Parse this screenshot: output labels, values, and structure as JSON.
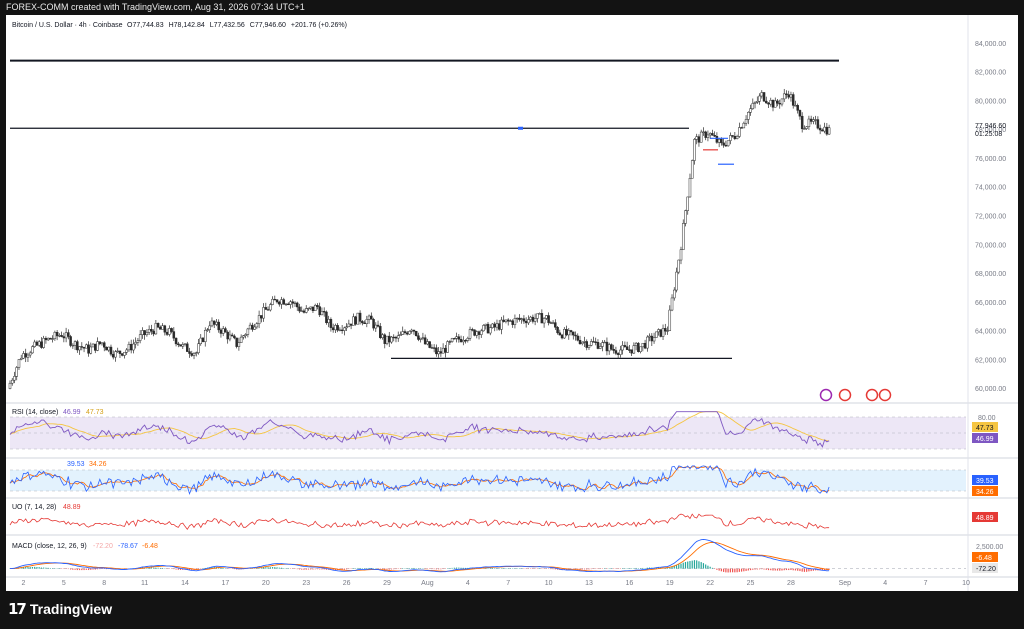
{
  "header_text": "FOREX-COMM created with TradingView.com, Aug 31, 2026 07:34 UTC+1",
  "symbol_line": {
    "name": "Bitcoin / U.S. Dollar · 4h · Coinbase",
    "o_label": "O",
    "o": "77,744.83",
    "h_label": "H",
    "h": "78,142.84",
    "l_label": "L",
    "l": "77,432.56",
    "c_label": "C",
    "c": "77,946.60",
    "change": "+201.76 (+0.26%)"
  },
  "price_axis": {
    "ticks": [
      "84,000.00",
      "82,000.00",
      "80,000.00",
      "78,000.00",
      "76,000.00",
      "74,000.00",
      "72,000.00",
      "70,000.00",
      "68,000.00",
      "66,000.00",
      "64,000.00",
      "62,000.00",
      "60,000.00"
    ],
    "current_price": "77,946.60",
    "countdown": "01:25:08"
  },
  "x_axis_ticks": [
    "2",
    "5",
    "8",
    "11",
    "14",
    "17",
    "20",
    "23",
    "26",
    "29",
    "Aug",
    "4",
    "7",
    "10",
    "13",
    "16",
    "19",
    "22",
    "25",
    "28",
    "Sep",
    "4",
    "7",
    "10"
  ],
  "indicators": {
    "rsi": {
      "title": "RSI (14, close)",
      "v1": "46.99",
      "v2": "47.73",
      "level": "80.00",
      "badge1": "47.73",
      "badge2": "46.99"
    },
    "stoch": {
      "v1": "39.53",
      "v2": "34.26",
      "badge1": "39.53",
      "badge2": "34.26"
    },
    "uo": {
      "title": "UO (7, 14, 28)",
      "v": "48.89",
      "badge": "48.89"
    },
    "macd": {
      "title": "MACD (close, 12, 26, 9)",
      "v1": "-72.20",
      "v2": "-78.67",
      "v3": "-6.48",
      "level": "2,500.00",
      "badge1": "-6.48",
      "badge2": "-72.20"
    }
  },
  "colors": {
    "up": "#2a2a2a",
    "down": "#2a2a2a",
    "rsi_line": "#7e57c2",
    "rsi_ma": "#f5c542",
    "stoch_k": "#2962ff",
    "stoch_d": "#ff6d00",
    "uo_line": "#e53935",
    "macd_line": "#2962ff",
    "signal_line": "#ff6d00",
    "badge_purple": "#7e57c2",
    "badge_yellow": "#f5c542",
    "badge_blue": "#2962ff",
    "badge_orange": "#ff6d00",
    "badge_red": "#e53935"
  },
  "footer": {
    "brand": "TradingView"
  },
  "chart_data": {
    "type": "candlestick",
    "title": "Bitcoin / U.S. Dollar · 4h · Coinbase",
    "ylim": [
      59000,
      85000
    ],
    "x_range": [
      "Jul 1",
      "Sep 10"
    ],
    "grid": false,
    "horizontal_lines": [
      82800,
      78100,
      62100
    ],
    "price_path": [
      [
        "Jul 1",
        60000
      ],
      [
        "Jul 2",
        62300
      ],
      [
        "Jul 3",
        62900
      ],
      [
        "Jul 4",
        63400
      ],
      [
        "Jul 5",
        63800
      ],
      [
        "Jul 6",
        63100
      ],
      [
        "Jul 7",
        62700
      ],
      [
        "Jul 8",
        63200
      ],
      [
        "Jul 9",
        62400
      ],
      [
        "Jul 10",
        62800
      ],
      [
        "Jul 11",
        63700
      ],
      [
        "Jul 12",
        64200
      ],
      [
        "Jul 13",
        63900
      ],
      [
        "Jul 14",
        62900
      ],
      [
        "Jul 15",
        62500
      ],
      [
        "Jul 16",
        64600
      ],
      [
        "Jul 17",
        64000
      ],
      [
        "Jul 18",
        63100
      ],
      [
        "Jul 19",
        64300
      ],
      [
        "Jul 20",
        65300
      ],
      [
        "Jul 21",
        66200
      ],
      [
        "Jul 22",
        66100
      ],
      [
        "Jul 23",
        65300
      ],
      [
        "Jul 24",
        65700
      ],
      [
        "Jul 25",
        64300
      ],
      [
        "Jul 26",
        64400
      ],
      [
        "Jul 27",
        64900
      ],
      [
        "Jul 28",
        64700
      ],
      [
        "Jul 29",
        63300
      ],
      [
        "Jul 30",
        63500
      ],
      [
        "Jul 31",
        64300
      ],
      [
        "Aug 1",
        63100
      ],
      [
        "Aug 2",
        62400
      ],
      [
        "Aug 3",
        63200
      ],
      [
        "Aug 4",
        63700
      ],
      [
        "Aug 5",
        64100
      ],
      [
        "Aug 6",
        64200
      ],
      [
        "Aug 7",
        64600
      ],
      [
        "Aug 8",
        64800
      ],
      [
        "Aug 9",
        64900
      ],
      [
        "Aug 10",
        64900
      ],
      [
        "Aug 11",
        63900
      ],
      [
        "Aug 12",
        63600
      ],
      [
        "Aug 13",
        63200
      ],
      [
        "Aug 14",
        63100
      ],
      [
        "Aug 15",
        62700
      ],
      [
        "Aug 16",
        62700
      ],
      [
        "Aug 17",
        62900
      ],
      [
        "Aug 18",
        63600
      ],
      [
        "Aug 19",
        64200
      ],
      [
        "Aug 20",
        70000
      ],
      [
        "Aug 21",
        77200
      ],
      [
        "Aug 22",
        77800
      ],
      [
        "Aug 23",
        76900
      ],
      [
        "Aug 24",
        77600
      ],
      [
        "Aug 25",
        79200
      ],
      [
        "Aug 26",
        80400
      ],
      [
        "Aug 27",
        79700
      ],
      [
        "Aug 28",
        80600
      ],
      [
        "Aug 29",
        78400
      ],
      [
        "Aug 30",
        78400
      ],
      [
        "Aug 31",
        77950
      ]
    ],
    "indicator_series": {
      "RSI (14, close)": {
        "last": [
          46.99,
          47.73
        ],
        "overbought": 80
      },
      "UO (7, 14, 28)": {
        "last": 48.89
      },
      "MACD (close, 12, 26, 9)": {
        "last": [
          -72.2,
          -78.67,
          -6.48
        ]
      }
    }
  }
}
